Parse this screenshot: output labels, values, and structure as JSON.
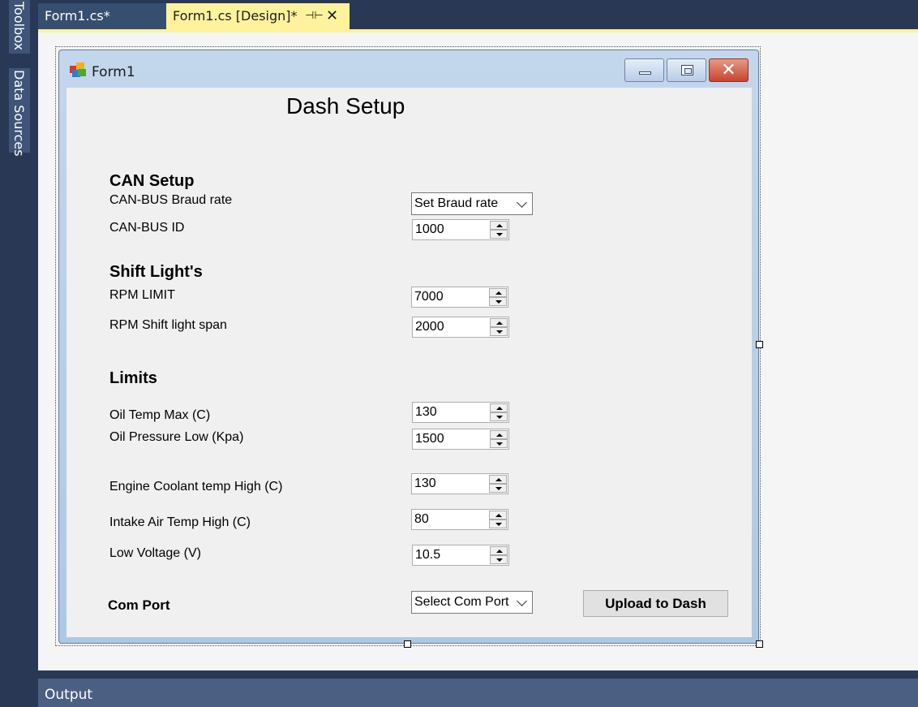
{
  "ide": {
    "left_tabs": {
      "toolbox": "Toolbox",
      "data_sources": "Data Sources"
    },
    "tabs": {
      "code": "Form1.cs*",
      "design": "Form1.cs [Design]*"
    },
    "output": "Output"
  },
  "form": {
    "title": "Form1",
    "heading": "Dash Setup",
    "can_setup": {
      "heading": "CAN Setup",
      "baud_label": "CAN-BUS Braud rate",
      "baud_value": "Set Braud rate",
      "id_label": "CAN-BUS ID",
      "id_value": "1000"
    },
    "shift_lights": {
      "heading": "Shift Light's",
      "rpm_limit_label": "RPM LIMIT",
      "rpm_limit_value": "7000",
      "span_label": "RPM Shift light span",
      "span_value": "2000"
    },
    "limits": {
      "heading": "Limits",
      "oil_temp_label": "Oil Temp Max (C)",
      "oil_temp_value": "130",
      "oil_pressure_label": "Oil Pressure Low (Kpa)",
      "oil_pressure_value": "1500",
      "coolant_label": "Engine Coolant temp High (C)",
      "coolant_value": "130",
      "intake_label": "Intake Air Temp High (C)",
      "intake_value": "80",
      "voltage_label": "Low Voltage (V)",
      "voltage_value": "10.5"
    },
    "com_port": {
      "label": "Com Port",
      "value": "Select Com Port"
    },
    "upload_label": "Upload to Dash"
  }
}
